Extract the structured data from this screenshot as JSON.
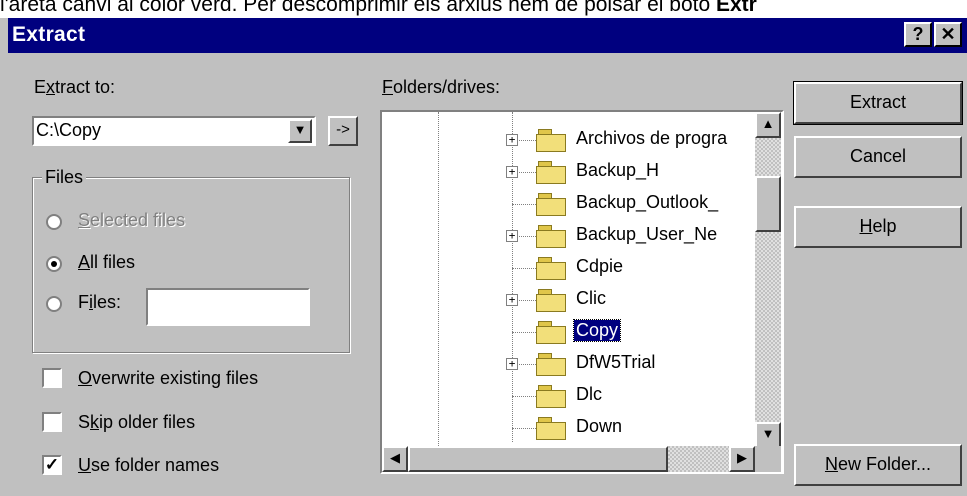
{
  "above_text": {
    "prefix": "l'areta canvi al color verd. Per descomprimir els arxius hem de polsar el botó ",
    "bold": "Extr"
  },
  "window": {
    "title": "Extract",
    "help_btn": "?",
    "close_btn": "✕"
  },
  "extract_to": {
    "label_pre": "E",
    "label_u": "x",
    "label_post": "tract to:",
    "value": "C:\\Copy",
    "browse_btn": "->"
  },
  "files_group": {
    "title": "Files",
    "options": [
      {
        "u": "S",
        "rest": "elected files",
        "selected": false,
        "enabled": false
      },
      {
        "u": "A",
        "rest": "ll files",
        "selected": true,
        "enabled": true
      },
      {
        "pre": "F",
        "u": "i",
        "rest": "les:",
        "selected": false,
        "enabled": true
      }
    ],
    "files_input": ""
  },
  "checkboxes": [
    {
      "u": "O",
      "rest": "verwrite existing files",
      "checked": false
    },
    {
      "pre": "S",
      "u": "k",
      "rest": "ip older files",
      "checked": false
    },
    {
      "u": "U",
      "rest": "se folder names",
      "checked": true
    }
  ],
  "folders": {
    "label_u": "F",
    "label_rest": "olders/drives:",
    "items": [
      {
        "name": "Archivos de progra",
        "expandable": true,
        "selected": false
      },
      {
        "name": "Backup_H",
        "expandable": true,
        "selected": false
      },
      {
        "name": "Backup_Outlook_",
        "expandable": false,
        "selected": false
      },
      {
        "name": "Backup_User_Ne",
        "expandable": true,
        "selected": false
      },
      {
        "name": "Cdpie",
        "expandable": false,
        "selected": false
      },
      {
        "name": "Clic",
        "expandable": true,
        "selected": false
      },
      {
        "name": "Copy",
        "expandable": false,
        "selected": true
      },
      {
        "name": "DfW5Trial",
        "expandable": true,
        "selected": false
      },
      {
        "name": "Dlc",
        "expandable": false,
        "selected": false
      },
      {
        "name": "Down",
        "expandable": false,
        "selected": false
      }
    ]
  },
  "buttons": {
    "extract": "Extract",
    "cancel": "Cancel",
    "help_u": "H",
    "help_rest": "elp",
    "new_folder_u": "N",
    "new_folder_rest": "ew Folder..."
  },
  "icons": {
    "expand": "plus-icon",
    "folder": "folder-icon",
    "open_folder": "open-folder-icon"
  }
}
